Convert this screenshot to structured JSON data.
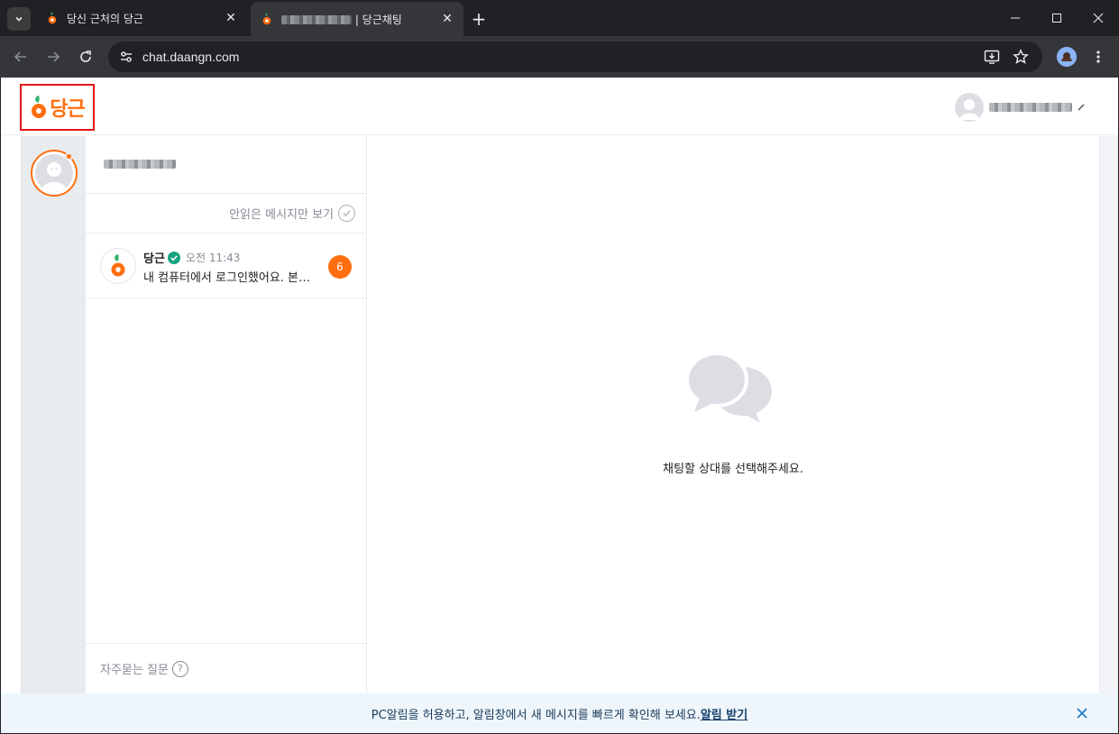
{
  "browser": {
    "tabs": [
      {
        "title": "당신 근처의 당근",
        "active": false
      },
      {
        "title": "| 당근채팅",
        "active": true
      }
    ],
    "url": "chat.daangn.com"
  },
  "header": {
    "logo_text": "당근"
  },
  "chat_list": {
    "filter_label": "안읽은 메시지만 보기",
    "items": [
      {
        "name": "당근",
        "time": "오전 11:43",
        "message": "내 컴퓨터에서 로그인했어요. 본인이 아니라면...",
        "unread": "6"
      }
    ],
    "faq_label": "자주묻는 질문",
    "faq_icon": "?"
  },
  "main": {
    "empty_message": "채팅할 상대를 선택해주세요."
  },
  "notice": {
    "text": "PC알림을 허용하고, 알림창에서 새 메시지를 빠르게 확인해 보세요.",
    "link": "알림 받기"
  },
  "colors": {
    "brand": "#ff6f0f",
    "highlight_border": "#e51717",
    "verified": "#16a37f"
  }
}
